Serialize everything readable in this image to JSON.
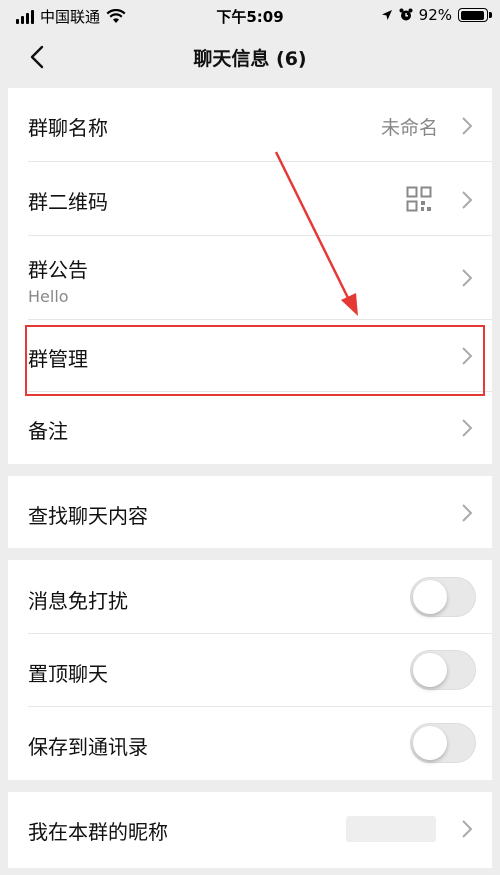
{
  "status_bar": {
    "carrier": "中国联通",
    "time": "下午5:09",
    "battery": "92%",
    "battery_level": 0.92
  },
  "nav": {
    "title": "聊天信息 (6)"
  },
  "group1": {
    "name_label": "群聊名称",
    "name_value": "未命名",
    "qr_label": "群二维码",
    "notice_label": "群公告",
    "notice_value": "Hello",
    "manage_label": "群管理",
    "remark_label": "备注"
  },
  "group2": {
    "search_label": "查找聊天内容"
  },
  "group3": {
    "mute_label": "消息免打扰",
    "mute_on": false,
    "pin_label": "置顶聊天",
    "pin_on": false,
    "save_label": "保存到通讯录",
    "save_on": false
  },
  "group4": {
    "nickname_label": "我在本群的昵称"
  },
  "colors": {
    "highlight": "#e53935",
    "background": "#ededed"
  }
}
